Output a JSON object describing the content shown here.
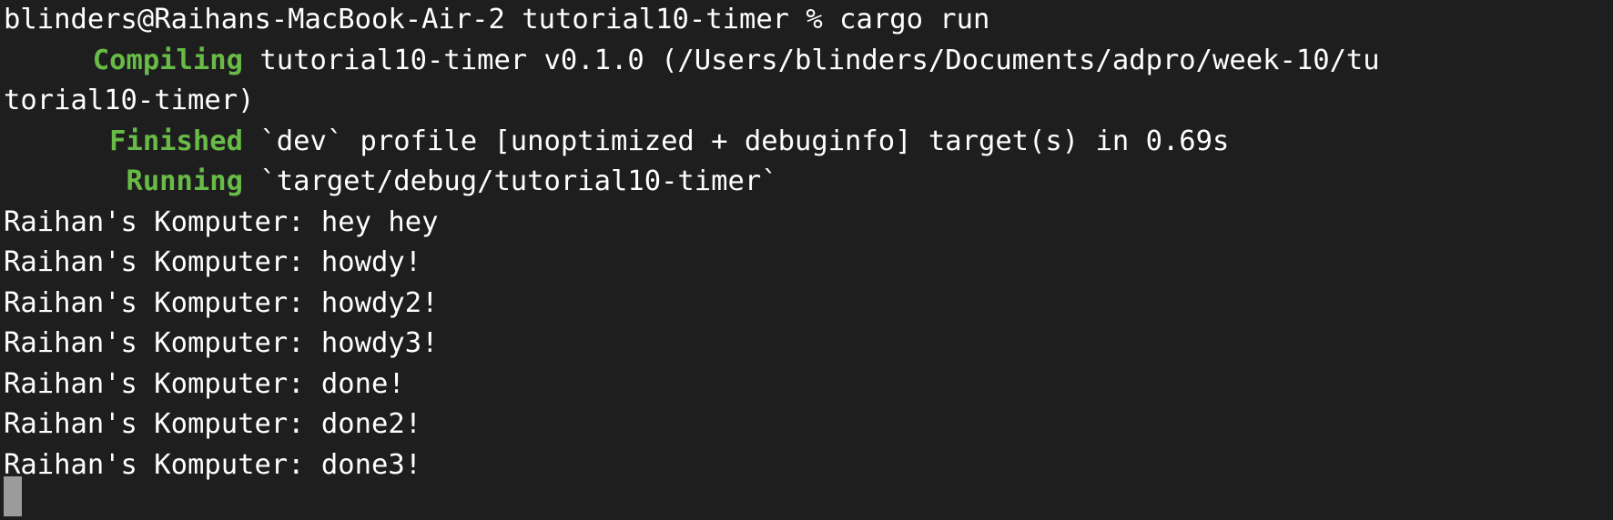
{
  "theme": {
    "background": "#1e1e1e",
    "foreground": "#ffffff",
    "status_color": "#68bb46",
    "cursor_color": "#9b9b9b"
  },
  "terminal": {
    "prompt_line": "blinders@Raihans-MacBook-Air-2 tutorial10-timer % cargo run",
    "compiling": {
      "status": "Compiling",
      "text": " tutorial10-timer v0.1.0 (/Users/blinders/Documents/adpro/week-10/tu",
      "wrap": "torial10-timer)"
    },
    "finished": {
      "status": "Finished",
      "text": " `dev` profile [unoptimized + debuginfo] target(s) in 0.69s"
    },
    "running": {
      "status": "Running",
      "text": " `target/debug/tutorial10-timer`"
    },
    "output_lines": [
      "Raihan's Komputer: hey hey",
      "Raihan's Komputer: howdy!",
      "Raihan's Komputer: howdy2!",
      "Raihan's Komputer: howdy3!",
      "Raihan's Komputer: done!",
      "Raihan's Komputer: done2!",
      "Raihan's Komputer: done3!"
    ]
  }
}
